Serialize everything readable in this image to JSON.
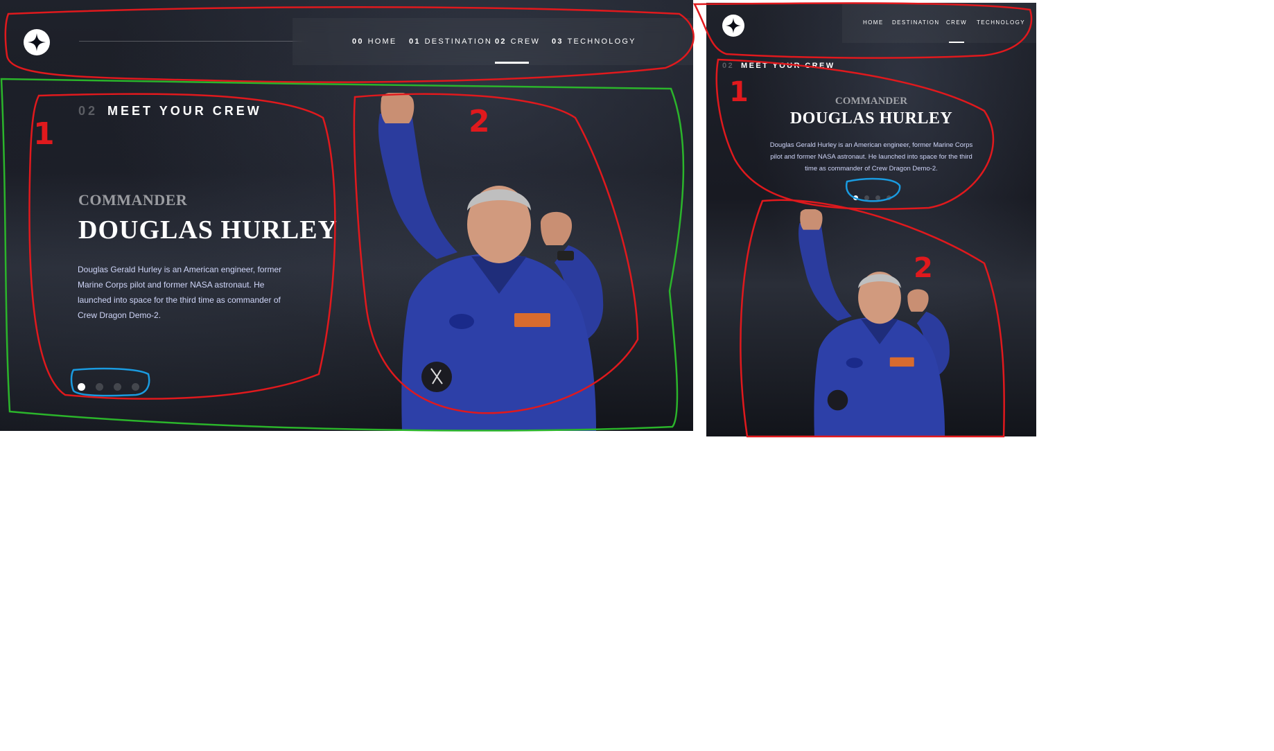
{
  "desktop": {
    "nav": [
      {
        "num": "00",
        "label": "HOME"
      },
      {
        "num": "01",
        "label": "DESTINATION"
      },
      {
        "num": "02",
        "label": "CREW"
      },
      {
        "num": "03",
        "label": "TECHNOLOGY"
      }
    ],
    "eyebrow": {
      "num": "02",
      "label": "MEET YOUR CREW"
    },
    "crew": {
      "role": "COMMANDER",
      "name": "DOUGLAS HURLEY",
      "bio": "Douglas Gerald Hurley is an American engineer, former Marine Corps pilot and former NASA astronaut. He launched into space for the third time as commander of Crew Dragon Demo-2."
    },
    "active_nav_index": 2,
    "active_dot": 0,
    "dot_count": 4
  },
  "mobile": {
    "nav": [
      "HOME",
      "DESTINATION",
      "CREW",
      "TECHNOLOGY"
    ],
    "eyebrow": {
      "num": "02",
      "label": "MEET YOUR CREW"
    },
    "crew": {
      "role": "COMMANDER",
      "name": "DOUGLAS HURLEY",
      "bio": "Douglas Gerald Hurley is an American engineer, former Marine Corps pilot and former NASA astronaut. He launched into space for the third time as commander of Crew Dragon Demo-2."
    }
  },
  "annotations": {
    "desktop_labels": [
      "1",
      "2"
    ],
    "mobile_labels": [
      "1",
      "2"
    ],
    "colors": {
      "region": "#e0191d",
      "outer": "#2bb52b",
      "dots": "#1a9be0"
    }
  },
  "theme": {
    "background": "#0b0d17",
    "text": "#ffffff",
    "accent": "#d0d6f9"
  }
}
